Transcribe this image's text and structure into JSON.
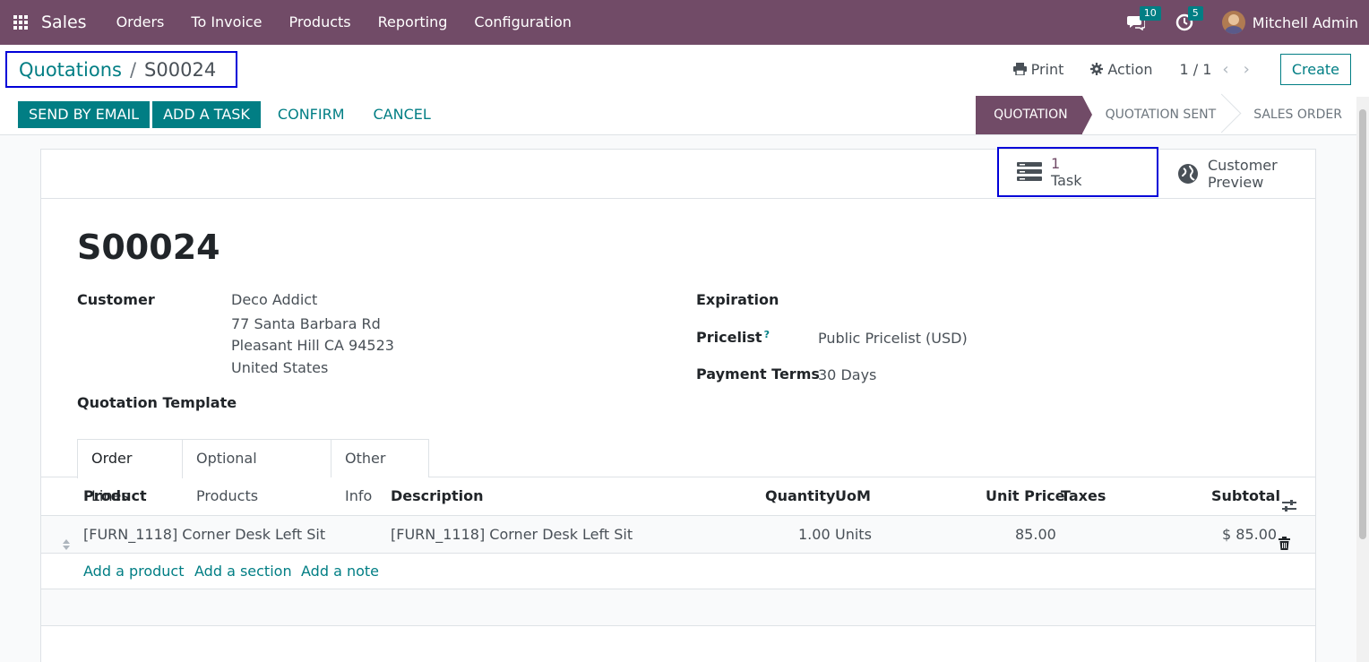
{
  "nav": {
    "app_name": "Sales",
    "menu": [
      "Orders",
      "To Invoice",
      "Products",
      "Reporting",
      "Configuration"
    ],
    "messages_count": "10",
    "activities_count": "5",
    "user_name": "Mitchell Admin"
  },
  "breadcrumb": {
    "parent": "Quotations",
    "separator": "/",
    "current": "S00024"
  },
  "control": {
    "print_label": "Print",
    "action_label": "Action",
    "pager": "1 / 1",
    "create_label": "Create"
  },
  "actions": {
    "send_email": "SEND BY EMAIL",
    "add_task": "ADD A TASK",
    "confirm": "CONFIRM",
    "cancel": "CANCEL"
  },
  "stages": [
    "QUOTATION",
    "QUOTATION SENT",
    "SALES ORDER"
  ],
  "active_stage": "QUOTATION",
  "smart_buttons": {
    "task_value": "1",
    "task_label": "Task",
    "preview_line1": "Customer",
    "preview_line2": "Preview"
  },
  "form": {
    "title": "S00024",
    "customer_label": "Customer",
    "customer_name": "Deco Addict",
    "address_line1": "77 Santa Barbara Rd",
    "address_line2": "Pleasant Hill CA 94523",
    "address_line3": "United States",
    "template_label": "Quotation Template",
    "expiration_label": "Expiration",
    "pricelist_label": "Pricelist",
    "pricelist_help": "?",
    "pricelist_value": "Public Pricelist (USD)",
    "payment_terms_label": "Payment Terms",
    "payment_terms_value": "30 Days"
  },
  "tabs": [
    "Order Lines",
    "Optional Products",
    "Other Info"
  ],
  "table": {
    "headers": {
      "product": "Product",
      "description": "Description",
      "quantity": "Quantity",
      "uom": "UoM",
      "unit_price": "Unit Price",
      "taxes": "Taxes",
      "subtotal": "Subtotal"
    },
    "rows": [
      {
        "product": "[FURN_1118] Corner Desk Left Sit",
        "description": "[FURN_1118] Corner Desk Left Sit",
        "quantity": "1.00",
        "uom": "Units",
        "unit_price": "85.00",
        "taxes": "",
        "subtotal": "$ 85.00"
      }
    ],
    "add_product": "Add a product",
    "add_section": "Add a section",
    "add_note": "Add a note"
  },
  "colors": {
    "brand": "#714b67",
    "accent": "#017e84",
    "highlight_box": "#0000d8"
  }
}
